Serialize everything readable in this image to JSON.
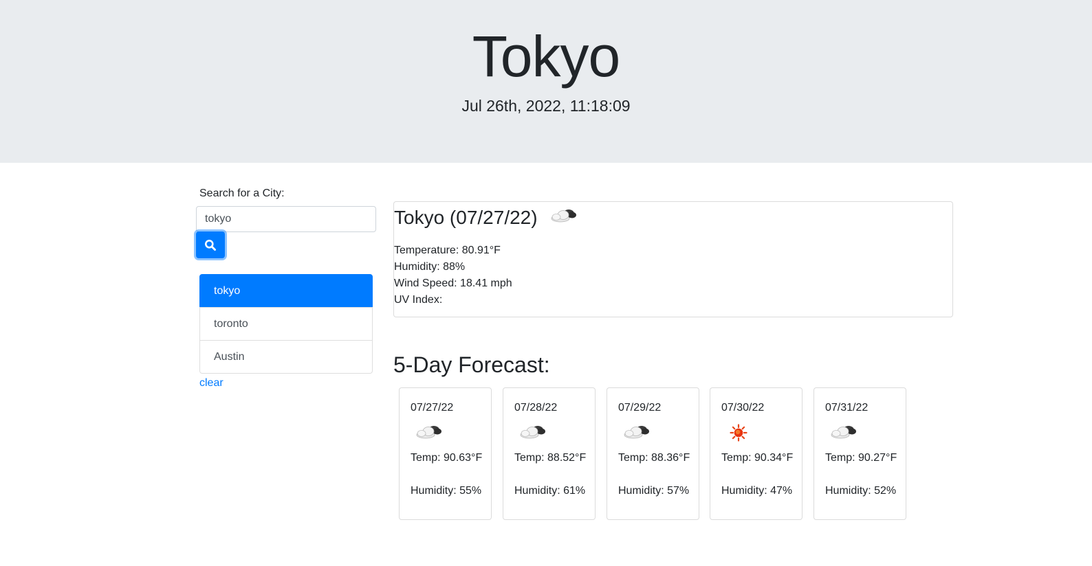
{
  "header": {
    "city_title": "Tokyo",
    "datetime": "Jul 26th, 2022, 11:18:09"
  },
  "search": {
    "label": "Search for a City:",
    "value": "tokyo",
    "button_icon": "search-icon"
  },
  "history": {
    "items": [
      {
        "label": "tokyo",
        "active": true
      },
      {
        "label": "toronto",
        "active": false
      },
      {
        "label": "Austin",
        "active": false
      }
    ],
    "clear_label": "clear"
  },
  "current": {
    "heading": "Tokyo (07/27/22)",
    "icon": "partly-cloudy-icon",
    "temperature": "Temperature: 80.91°F",
    "humidity": "Humidity: 88%",
    "wind": "Wind Speed: 18.41 mph",
    "uv": "UV Index:"
  },
  "forecast": {
    "title": "5-Day Forecast:",
    "days": [
      {
        "date": "07/27/22",
        "icon": "partly-cloudy-icon",
        "temp": "Temp: 90.63°F",
        "humidity": "Humidity: 55%"
      },
      {
        "date": "07/28/22",
        "icon": "partly-cloudy-icon",
        "temp": "Temp: 88.52°F",
        "humidity": "Humidity: 61%"
      },
      {
        "date": "07/29/22",
        "icon": "partly-cloudy-icon",
        "temp": "Temp: 88.36°F",
        "humidity": "Humidity: 57%"
      },
      {
        "date": "07/30/22",
        "icon": "sun-icon",
        "temp": "Temp: 90.34°F",
        "humidity": "Humidity: 47%"
      },
      {
        "date": "07/31/22",
        "icon": "partly-cloudy-icon",
        "temp": "Temp: 90.27°F",
        "humidity": "Humidity: 52%"
      }
    ]
  },
  "colors": {
    "header_bg": "#e9ecef",
    "primary": "#007bff",
    "text": "#212529"
  }
}
